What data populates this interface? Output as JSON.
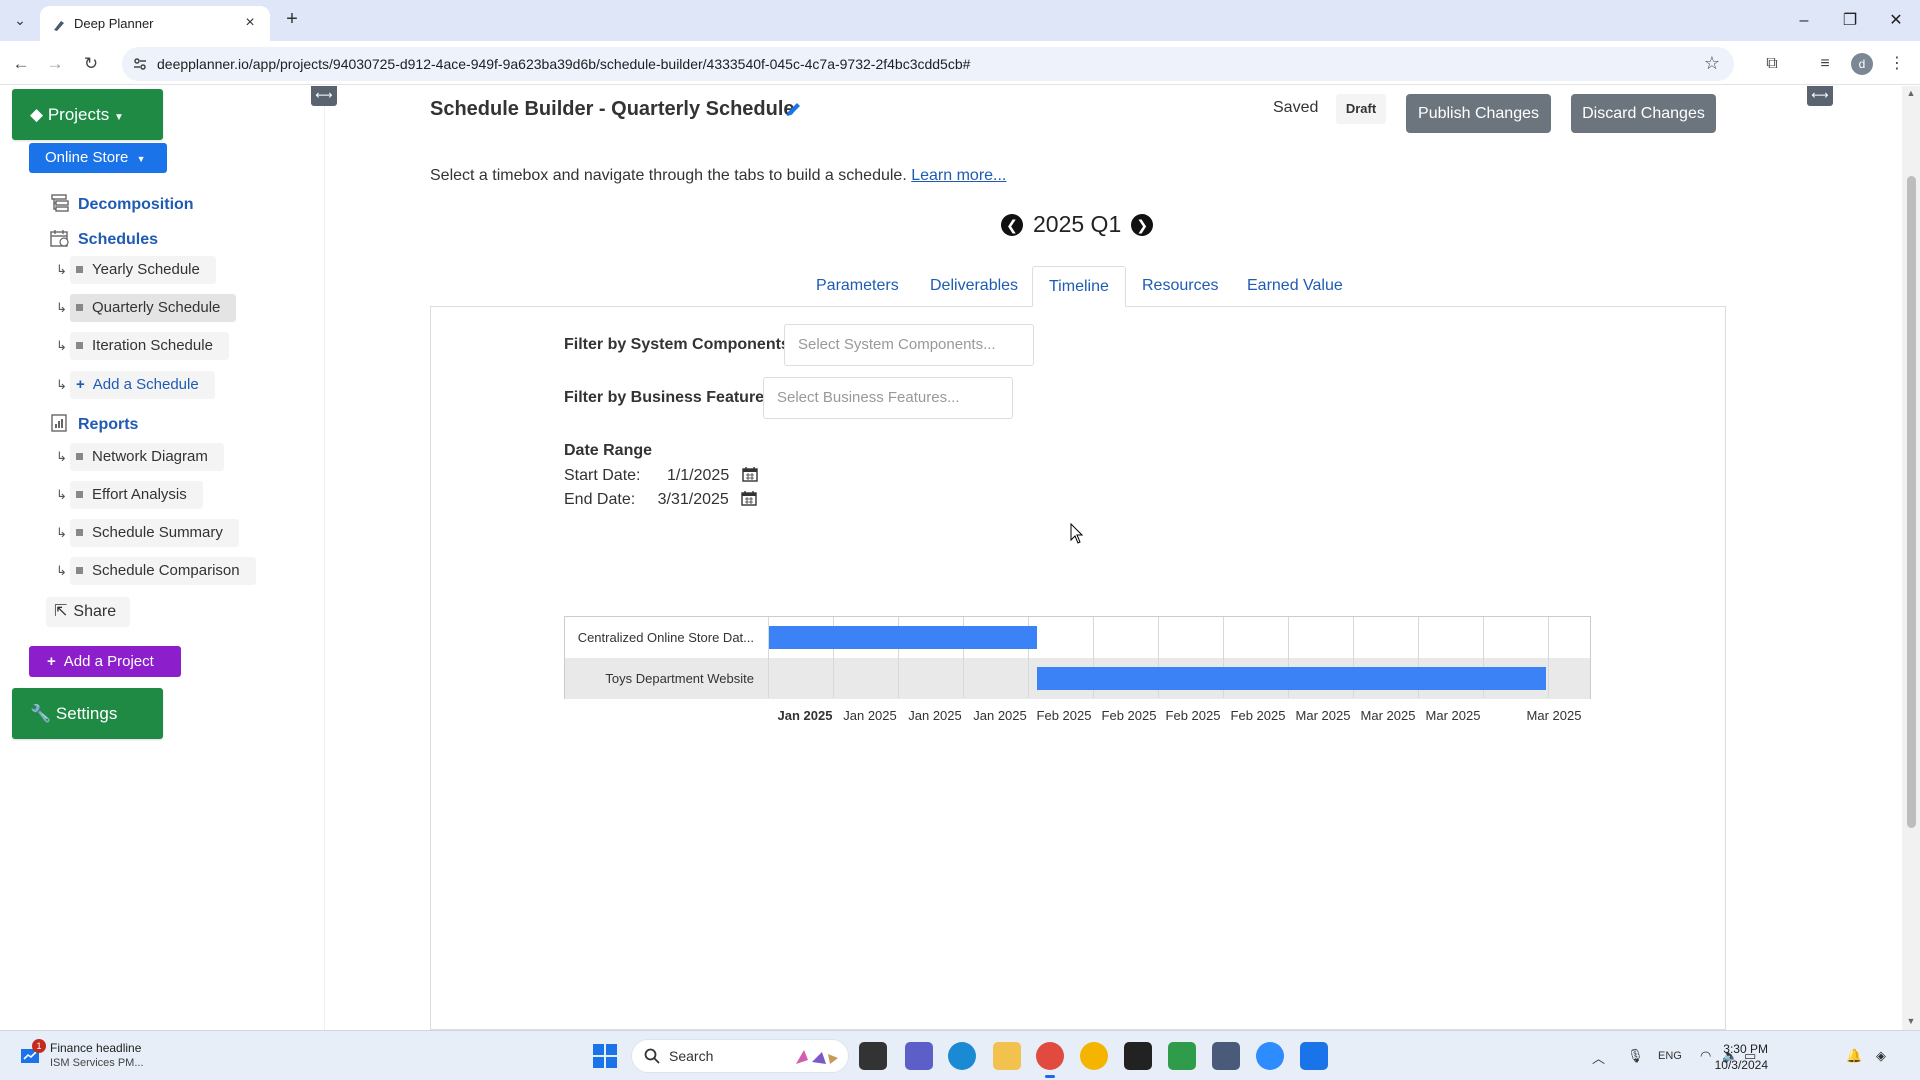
{
  "browser": {
    "tab_title": "Deep Planner",
    "url": "deepplanner.io/app/projects/94030725-d912-4ace-949f-9a623ba39d6b/schedule-builder/4333540f-045c-4c7a-9732-2f4bc3cdd5cb#",
    "profile_initial": "d"
  },
  "sidebar": {
    "projects_label": "Projects",
    "project_selector": "Online Store",
    "decomposition": "Decomposition",
    "schedules": "Schedules",
    "schedule_items": [
      {
        "label": "Yearly Schedule",
        "active": false
      },
      {
        "label": "Quarterly Schedule",
        "active": true
      },
      {
        "label": "Iteration Schedule",
        "active": false
      }
    ],
    "add_schedule": "Add a Schedule",
    "reports": "Reports",
    "report_items": [
      {
        "label": "Network Diagram"
      },
      {
        "label": "Effort Analysis"
      },
      {
        "label": "Schedule Summary"
      },
      {
        "label": "Schedule Comparison"
      }
    ],
    "share": "Share",
    "add_project": "Add a Project",
    "settings": "Settings"
  },
  "header": {
    "title": "Schedule Builder - Quarterly Schedule",
    "status": "Saved",
    "badge": "Draft",
    "publish": "Publish Changes",
    "discard": "Discard Changes"
  },
  "intro": {
    "text": "Select a timebox and navigate through the tabs to build a schedule.",
    "link": "Learn more..."
  },
  "period": "2025 Q1",
  "tabs": [
    {
      "label": "Parameters",
      "active": false
    },
    {
      "label": "Deliverables",
      "active": false
    },
    {
      "label": "Timeline",
      "active": true
    },
    {
      "label": "Resources",
      "active": false
    },
    {
      "label": "Earned Value",
      "active": false
    }
  ],
  "filters": {
    "system_label": "Filter by System Components:",
    "system_placeholder": "Select System Components...",
    "business_label": "Filter by Business Features:",
    "business_placeholder": "Select Business Features..."
  },
  "date_range": {
    "title": "Date Range",
    "start_label": "Start Date:",
    "start_value": "1/1/2025",
    "end_label": "End Date:",
    "end_value": "3/31/2025"
  },
  "timeline": {
    "rows": [
      {
        "label": "Centralized Online Store Dat..."
      },
      {
        "label": "Toys Department Website"
      }
    ],
    "ticks": [
      "Jan 2025",
      "Jan 2025",
      "Jan 2025",
      "Jan 2025",
      "Feb 2025",
      "Feb 2025",
      "Feb 2025",
      "Feb 2025",
      "Mar 2025",
      "Mar 2025",
      "Mar 2025",
      "Mar 2025"
    ]
  },
  "taskbar": {
    "news_title": "Finance headline",
    "news_sub": "ISM Services PM...",
    "news_badge": "1",
    "search": "Search",
    "lang": "ENG",
    "time": "3:30 PM",
    "date": "10/3/2024"
  },
  "colors": {
    "green": "#1e8a43",
    "blue": "#1a73e8",
    "purple": "#8c1fcb",
    "gantt_bar": "#3b82f6",
    "link": "#1f5bb3"
  }
}
